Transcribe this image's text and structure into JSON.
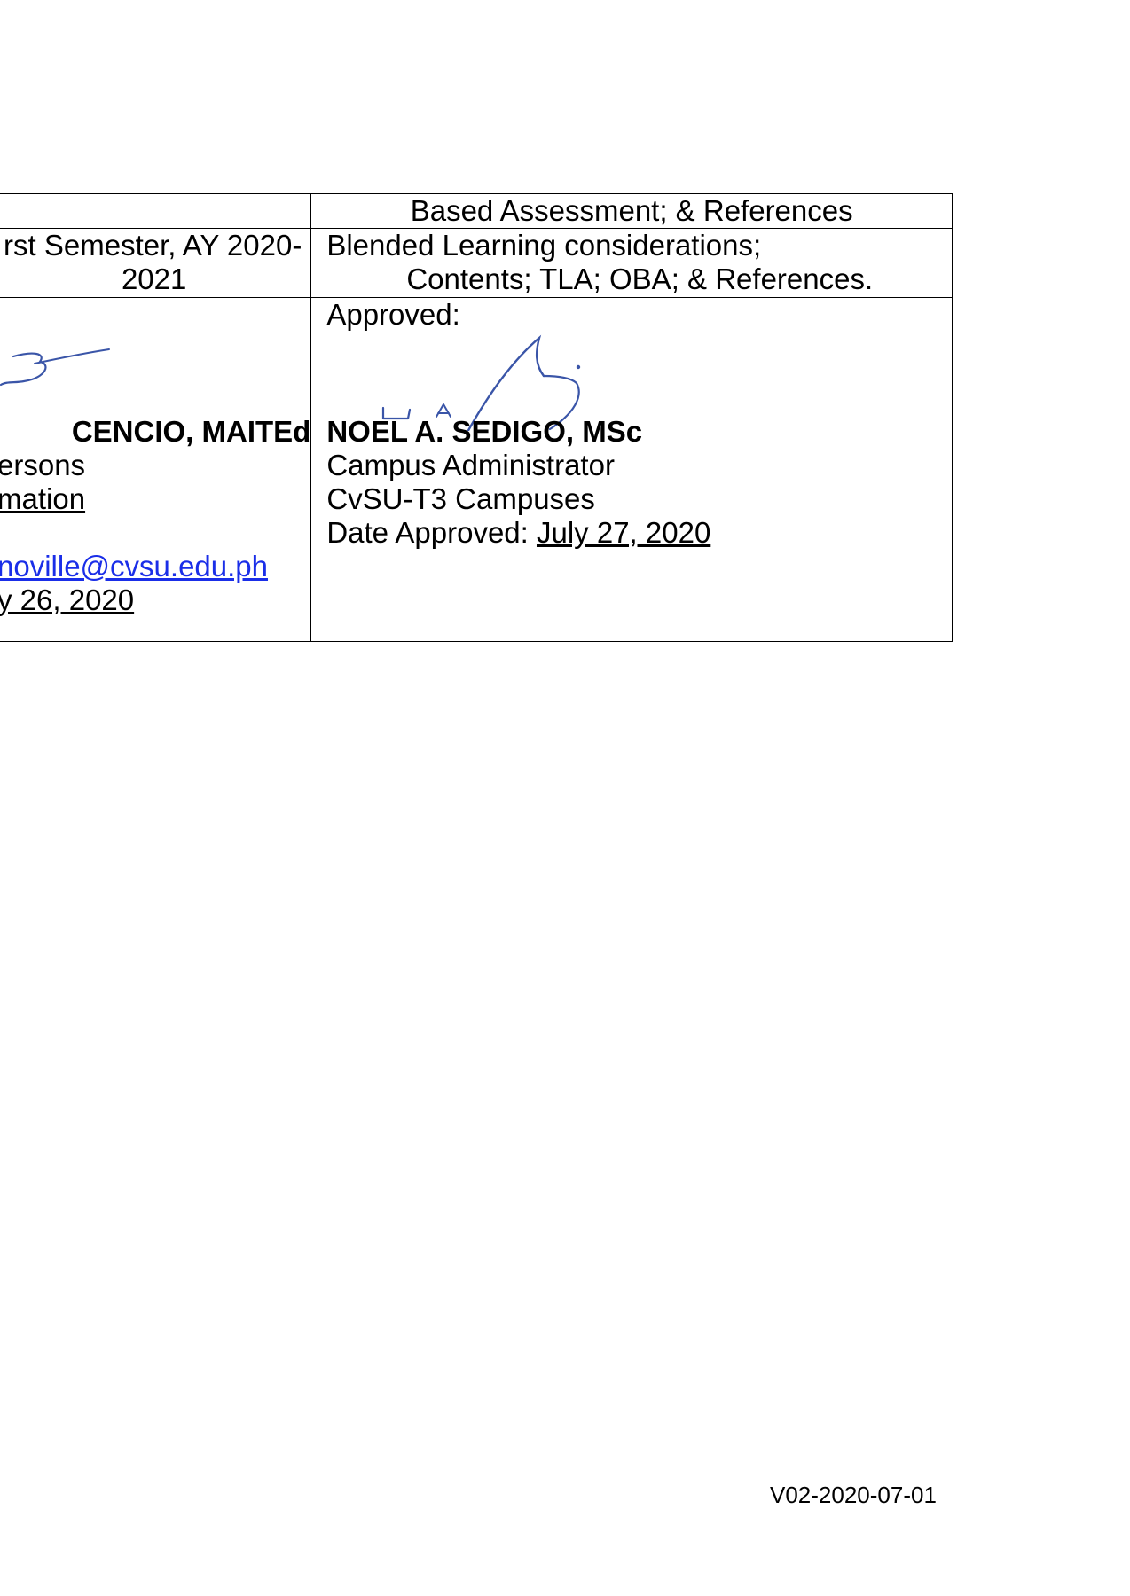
{
  "table": {
    "row1": {
      "left": "",
      "right": "Based Assessment; & References"
    },
    "row2": {
      "left_line1": "rst Semester, AY 2020-",
      "left_line2": "2021",
      "right_line1": "Blended Learning considerations;",
      "right_line2": "Contents; TLA; OBA; & References."
    },
    "row3": {
      "left": {
        "name": "CENCIO, MAITEd",
        "title": "ersons",
        "office": "mation",
        "email": "noville@cvsu.edu.ph",
        "date": "y 26, 2020"
      },
      "right": {
        "heading": "Approved:",
        "name": "NOEL A. SEDIGO, MSc",
        "title": "Campus Administrator",
        "office": "CvSU-T3 Campuses",
        "date_label": "Date Approved: ",
        "date_value": "July 27, 2020"
      }
    }
  },
  "footer": {
    "version_code": "V02-2020-07-01"
  },
  "colors": {
    "signature_ink": "#3a55a8",
    "link": "#1a2ee8"
  }
}
